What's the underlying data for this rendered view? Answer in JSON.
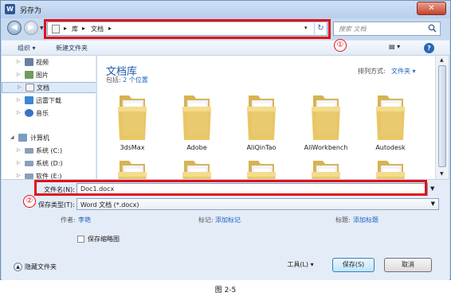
{
  "window": {
    "title": "另存为",
    "app_icon_letter": "W",
    "close_glyph": "✕"
  },
  "address": {
    "crumbs": [
      "库",
      "文档"
    ],
    "separator": "▸",
    "dropdown": "▾",
    "refresh": "↻"
  },
  "search": {
    "placeholder": "搜索 文档"
  },
  "annotations": {
    "one": "①",
    "two": "②"
  },
  "toolbar": {
    "organize": "组织 ▾",
    "new_folder": "新建文件夹",
    "view": "▤ ▾",
    "help": "?"
  },
  "navpane": {
    "items": [
      {
        "label": "视频",
        "color": "#6b7fa3"
      },
      {
        "label": "图片",
        "color": "#6f9d5a"
      },
      {
        "label": "文档",
        "color": "#f0f0f0"
      },
      {
        "label": "迅雷下载",
        "color": "#3f86d6"
      },
      {
        "label": "音乐",
        "color": "#3a72c4"
      },
      {
        "label": "计算机",
        "color": "#7e9bc0"
      },
      {
        "label": "系统 (C:)",
        "color": "#8aa0b8"
      },
      {
        "label": "系统 (D:)",
        "color": "#8aa0b8"
      },
      {
        "label": "软件 (E:)",
        "color": "#8aa0b8"
      }
    ]
  },
  "content": {
    "library_title": "文档库",
    "includes_label": "包括:",
    "includes_link": "2 个位置",
    "sort_label": "排列方式:",
    "sort_value": "文件夹 ▾",
    "folders": [
      "3dsMax",
      "Adobe",
      "AliQinTao",
      "AliWorkbench",
      "Autodesk",
      "",
      "",
      "",
      "",
      ""
    ]
  },
  "form": {
    "filename_label": "文件名(N):",
    "filename_value": "Doc1.docx",
    "type_label": "保存类型(T):",
    "type_value": "Word 文档 (*.docx)",
    "author_label": "作者:",
    "author_value": "李艳",
    "tags_label": "标记:",
    "tags_value": "添加标记",
    "title_label": "标题:",
    "title_value": "添加标题",
    "thumbnail_label": "保存缩略图",
    "hide_folders": "隐藏文件夹",
    "tools": "工具(L)  ▾",
    "save": "保存(S)",
    "cancel": "取消"
  },
  "caption": "图 2-5",
  "colors": {
    "highlight": "#e0111c",
    "link": "#1e62c0",
    "title": "#1e5aa8",
    "folder": "#e9c766"
  }
}
